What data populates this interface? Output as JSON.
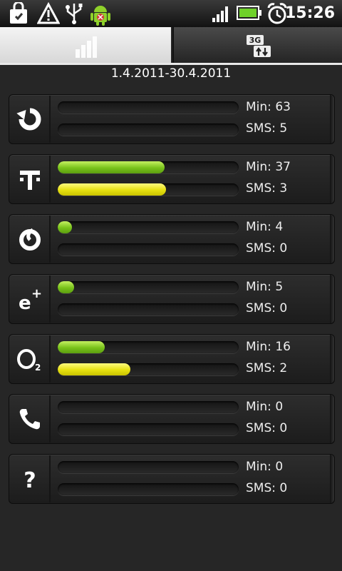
{
  "status_bar": {
    "time": "15:26",
    "icons": [
      "shopping-bag-icon",
      "warning-icon",
      "usb-icon",
      "android-bug-icon",
      "signal-icon",
      "battery-icon",
      "alarm-icon"
    ]
  },
  "tabs": [
    {
      "name": "tab-statistics",
      "icon": "bar-chart-icon",
      "active": true
    },
    {
      "name": "tab-3g-data",
      "icon": "3g-data-icon",
      "active": false
    }
  ],
  "period": "1.4.2011-30.4.2011",
  "operators": [
    {
      "icon": "refresh-icon",
      "min_label": "Min:",
      "min_value": "63",
      "sms_label": "SMS:",
      "sms_value": "5",
      "min_fill": 0.0,
      "sms_fill": 0.0
    },
    {
      "icon": "t-mobile-icon",
      "min_label": "Min:",
      "min_value": "37",
      "sms_label": "SMS:",
      "sms_value": "3",
      "min_fill": 0.59,
      "sms_fill": 0.6
    },
    {
      "icon": "vodafone-icon",
      "min_label": "Min:",
      "min_value": "4",
      "sms_label": "SMS:",
      "sms_value": "0",
      "min_fill": 0.08,
      "sms_fill": 0.0
    },
    {
      "icon": "eplus-icon",
      "min_label": "Min:",
      "min_value": "5",
      "sms_label": "SMS:",
      "sms_value": "0",
      "min_fill": 0.09,
      "sms_fill": 0.0
    },
    {
      "icon": "o2-icon",
      "min_label": "Min:",
      "min_value": "16",
      "sms_label": "SMS:",
      "sms_value": "2",
      "min_fill": 0.26,
      "sms_fill": 0.4
    },
    {
      "icon": "phone-icon",
      "min_label": "Min:",
      "min_value": "0",
      "sms_label": "SMS:",
      "sms_value": "0",
      "min_fill": 0.0,
      "sms_fill": 0.0
    },
    {
      "icon": "unknown-icon",
      "min_label": "Min:",
      "min_value": "0",
      "sms_label": "SMS:",
      "sms_value": "0",
      "min_fill": 0.0,
      "sms_fill": 0.0
    }
  ],
  "colors": {
    "min_bar": "#78c21a",
    "sms_bar": "#e6e010",
    "background": "#262626"
  }
}
